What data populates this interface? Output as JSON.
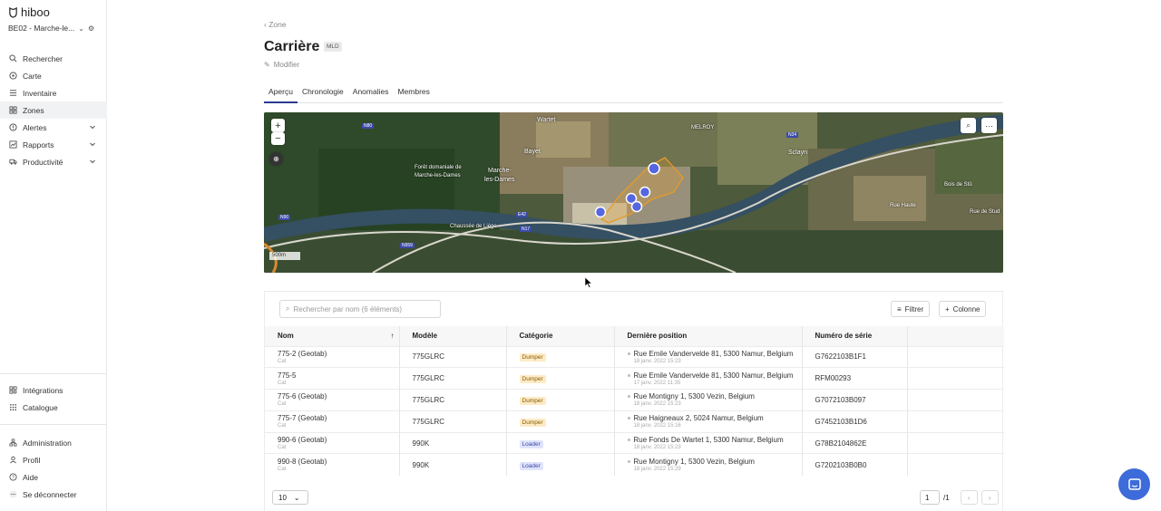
{
  "sidebar": {
    "logo": "hiboo",
    "org": "BE02 - Marche-le...",
    "items": [
      {
        "label": "Rechercher",
        "icon": "search-icon"
      },
      {
        "label": "Carte",
        "icon": "map-pin-icon"
      },
      {
        "label": "Inventaire",
        "icon": "list-icon"
      },
      {
        "label": "Zones",
        "icon": "grid-icon",
        "active": true
      },
      {
        "label": "Alertes",
        "icon": "shield-icon"
      },
      {
        "label": "Rapports",
        "icon": "chart-icon"
      },
      {
        "label": "Productivité",
        "icon": "truck-icon"
      }
    ],
    "bottom_items": [
      {
        "label": "Intégrations",
        "icon": "puzzle-icon"
      },
      {
        "label": "Catalogue",
        "icon": "apps-icon"
      }
    ],
    "footer_items": [
      {
        "label": "Administration",
        "icon": "hierarchy-icon"
      },
      {
        "label": "Profil",
        "icon": "user-icon"
      },
      {
        "label": "Aide",
        "icon": "help-icon"
      },
      {
        "label": "Se déconnecter",
        "icon": "more-icon"
      }
    ]
  },
  "page": {
    "breadcrumb": "Zone",
    "title": "Carrière",
    "badge": "MLD",
    "edit_label": "Modifier",
    "tabs": [
      "Aperçu",
      "Chronologie",
      "Anomalies",
      "Membres"
    ]
  },
  "map": {
    "zoom_in": "+",
    "zoom_out": "−",
    "scale": "500m",
    "labels": {
      "wartet": "Wartet",
      "melroy": "MELROY",
      "bayet": "Bayet",
      "foret": "Forêt domaniale de",
      "foret2": "Marche-les-Dames",
      "marche": "Marche-",
      "marche2": "les-Dames",
      "sclayn": "Sclayn",
      "bois": "Bois de Stû",
      "chaussee": "Chaussée de Liège",
      "rue_stud": "Rue de Stud",
      "rue_haut": "Rue Haute"
    },
    "roads": {
      "n80": "N80",
      "n90": "N90",
      "n959": "N959",
      "n17": "N17",
      "e42": "E42",
      "n34": "N34"
    }
  },
  "table": {
    "search_placeholder": "Rechercher par nom (6 éléments)",
    "filter_label": "Filtrer",
    "column_label": "Colonne",
    "headers": [
      "Nom",
      "Modèle",
      "Catégorie",
      "Dernière position",
      "Numéro de série"
    ],
    "rows": [
      {
        "name": "775-2 (Geotab)",
        "brand": "Cat",
        "model": "775GLRC",
        "category": "Dumper",
        "address": "Rue Emile Vandervelde 81, 5300 Namur, Belgium",
        "date": "18 janv. 2022 15:23",
        "serial": "G7622103B1F1"
      },
      {
        "name": "775-5",
        "brand": "Cat",
        "model": "775GLRC",
        "category": "Dumper",
        "address": "Rue Emile Vandervelde 81, 5300 Namur, Belgium",
        "date": "17 janv. 2022 11:35",
        "serial": "RFM00293"
      },
      {
        "name": "775-6 (Geotab)",
        "brand": "Cat",
        "model": "775GLRC",
        "category": "Dumper",
        "address": "Rue Montigny 1, 5300 Vezin, Belgium",
        "date": "18 janv. 2022 15:23",
        "serial": "G7072103B097"
      },
      {
        "name": "775-7 (Geotab)",
        "brand": "Cat",
        "model": "775GLRC",
        "category": "Dumper",
        "address": "Rue Haigneaux 2, 5024 Namur, Belgium",
        "date": "18 janv. 2022 15:16",
        "serial": "G7452103B1D6"
      },
      {
        "name": "990-6 (Geotab)",
        "brand": "Cat",
        "model": "990K",
        "category": "Loader",
        "address": "Rue Fonds De Wartet 1, 5300 Namur, Belgium",
        "date": "18 janv. 2022 15:23",
        "serial": "G78B2104862E"
      },
      {
        "name": "990-8 (Geotab)",
        "brand": "Cat",
        "model": "990K",
        "category": "Loader",
        "address": "Rue Montigny 1, 5300 Vezin, Belgium",
        "date": "18 janv. 2022 15:29",
        "serial": "G7202103B0B0"
      }
    ],
    "page_size": "10",
    "page_current": "1",
    "page_total": "/1"
  }
}
